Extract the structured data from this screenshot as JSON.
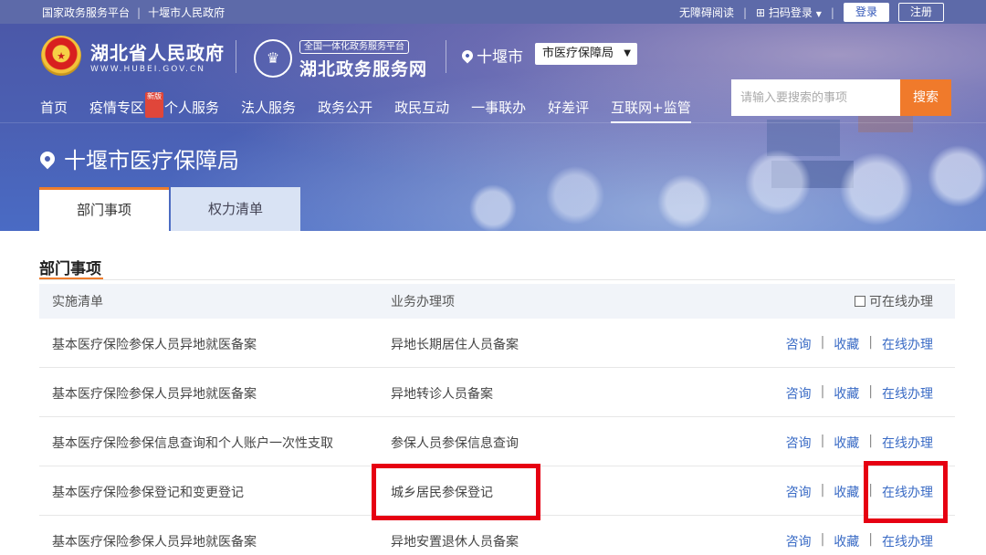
{
  "topbar": {
    "left_links": [
      "国家政务服务平台",
      "十堰市人民政府"
    ],
    "accessibility": "无障碍阅读",
    "scan_login": "扫码登录",
    "login": "登录",
    "register": "注册"
  },
  "header": {
    "gov_name": "湖北省人民政府",
    "gov_url": "WWW.HUBEI.GOV.CN",
    "platform_badge": "全国一体化政务服务平台",
    "platform_name": "湖北政务服务网",
    "city": "十堰市",
    "dept_select": "市医疗保障局",
    "search_placeholder": "请输入要搜索的事项",
    "search_button": "搜索"
  },
  "nav": {
    "items": [
      "首页",
      "疫情专区",
      "个人服务",
      "法人服务",
      "政务公开",
      "政民互动",
      "一事联办",
      "好差评",
      "互联网+监管"
    ],
    "new_tag": "新版",
    "active_index": 8
  },
  "page": {
    "title": "十堰市医疗保障局",
    "tabs": [
      "部门事项",
      "权力清单"
    ],
    "active_tab": 0
  },
  "section": {
    "title": "部门事项"
  },
  "table": {
    "headers": [
      "实施清单",
      "业务办理项",
      "可在线办理"
    ],
    "actions": [
      "咨询",
      "收藏",
      "在线办理"
    ],
    "action_separator": "|",
    "rows": [
      {
        "list": "基本医疗保险参保人员异地就医备案",
        "item": "异地长期居住人员备案"
      },
      {
        "list": "基本医疗保险参保人员异地就医备案",
        "item": "异地转诊人员备案"
      },
      {
        "list": "基本医疗保险参保信息查询和个人账户一次性支取",
        "item": "参保人员参保信息查询"
      },
      {
        "list": "基本医疗保险参保登记和变更登记",
        "item": "城乡居民参保登记"
      },
      {
        "list": "基本医疗保险参保人员异地就医备案",
        "item": "异地安置退休人员备案"
      }
    ]
  },
  "colors": {
    "accent_orange": "#ee7d2c",
    "link_blue": "#3a6bc5",
    "highlight_red": "#e60012",
    "banner_blue": "#4b5fb2"
  }
}
